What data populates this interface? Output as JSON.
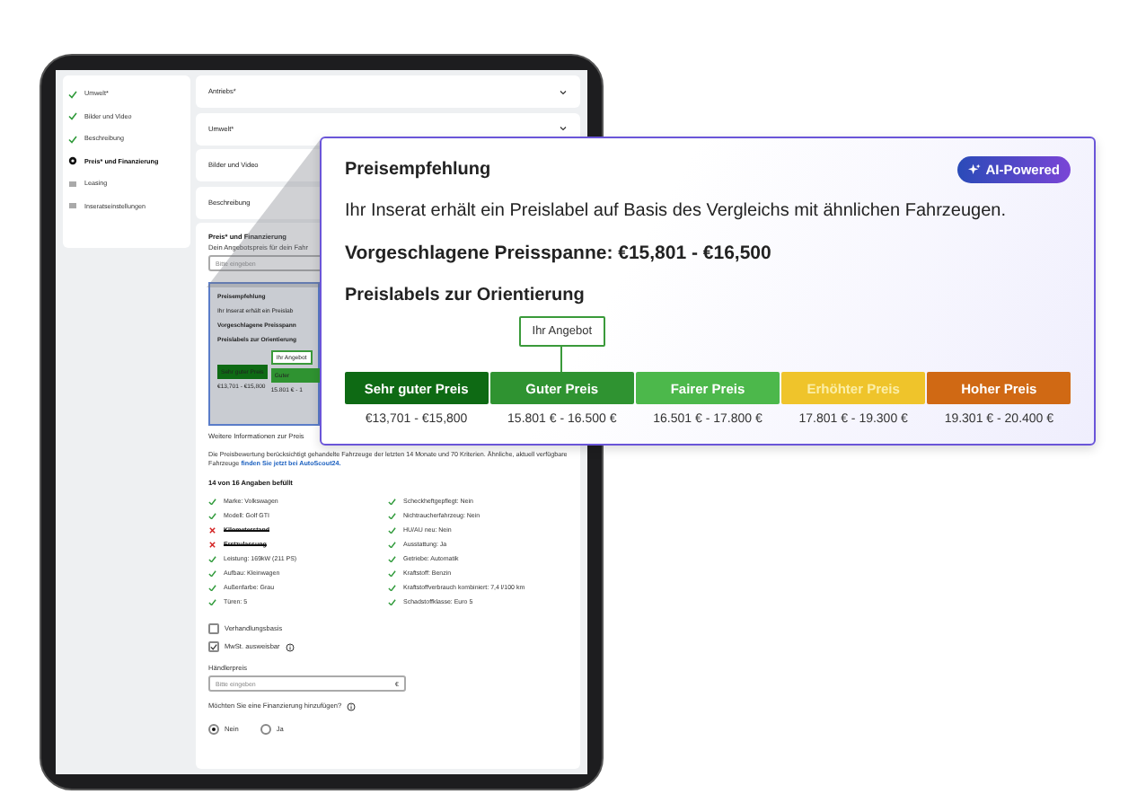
{
  "sidebar": {
    "items": [
      {
        "label": "Umwelt*",
        "kind": "done",
        "selected": false
      },
      {
        "label": "Bilder und Video",
        "kind": "done",
        "selected": false
      },
      {
        "label": "Beschreibung",
        "kind": "done",
        "selected": false
      },
      {
        "label": "Preis* und Finanzierung",
        "kind": "current",
        "selected": true
      },
      {
        "label": "Leasing",
        "kind": "todo",
        "selected": false
      },
      {
        "label": "Inseratseinstellungen",
        "kind": "todo",
        "selected": false
      }
    ]
  },
  "sections": [
    {
      "title": "Antriebs*"
    },
    {
      "title": "Umwelt*"
    },
    {
      "title": "Bilder und Video"
    },
    {
      "title": "Beschreibung"
    }
  ],
  "price_section": {
    "title": "Preis* und Finanzierung",
    "hint": "Dein Angebotspreis für dein Fahr",
    "placeholder": "Bitte eingeben",
    "preview": {
      "title": "Preisempfehlung",
      "text": "Ihr Inserat erhält ein Preislab",
      "range": "Vorgeschlagene Preisspann",
      "labels_heading": "Preislabels zur Orientierung",
      "marker": "Ihr Angebot",
      "labels": [
        {
          "label": "Sehr guter Preis",
          "range": "€13,701 - €15,800",
          "color": "#0e6a14",
          "selected": false
        },
        {
          "label": "Guter",
          "range": "15.801 € - 1",
          "color": "#2f9331",
          "selected": true
        }
      ]
    },
    "more_info": "Weitere Informationen zur Preis",
    "note": "Die Preisbewertung berücksichtigt gehandelte Fahrzeuge der letzten 14 Monate und 70 Kriterien. Ähnliche, aktuell verfügbare Fahrzeuge ",
    "note_link": "finden Sie jetzt bei AutoScout24.",
    "filled": "14 von 16 Angaben befüllt",
    "attributes_left": [
      {
        "text": "Marke: Volkswagen",
        "ok": true
      },
      {
        "text": "Modell: Golf GTI",
        "ok": true
      },
      {
        "text": "Kilometerstand",
        "ok": false
      },
      {
        "text": "Erstzulassung",
        "ok": false
      },
      {
        "text": "Leistung: 169kW (211 PS)",
        "ok": true
      },
      {
        "text": "Aufbau: Kleinwagen",
        "ok": true
      },
      {
        "text": "Außenfarbe: Grau",
        "ok": true
      },
      {
        "text": "Türen: 5",
        "ok": true
      }
    ],
    "attributes_right": [
      {
        "text": "Scheckheftgepflegt: Nein",
        "ok": true
      },
      {
        "text": "Nichtraucherfahrzeug: Nein",
        "ok": true
      },
      {
        "text": "HU/AU neu: Nein",
        "ok": true
      },
      {
        "text": "Ausstattung: Ja",
        "ok": true
      },
      {
        "text": "Getriebe: Automatik",
        "ok": true
      },
      {
        "text": "Kraftstoff: Benzin",
        "ok": true
      },
      {
        "text": "Kraftstoffverbrauch kombiniert: 7,4 l/100 km",
        "ok": true
      },
      {
        "text": "Schadstoffklasse: Euro 5",
        "ok": true
      }
    ],
    "checkboxes": [
      {
        "label": "Verhandlungsbasis",
        "checked": false,
        "info": false
      },
      {
        "label": "MwSt. ausweisbar",
        "checked": true,
        "info": true
      }
    ],
    "dealer_price": {
      "label": "Händlerpreis",
      "placeholder": "Bitte eingeben",
      "unit": "€"
    },
    "financing": {
      "question": "Möchten Sie eine Finanzierung hinzufügen?",
      "options": [
        {
          "label": "Nein",
          "selected": true
        },
        {
          "label": "Ja",
          "selected": false
        }
      ]
    }
  },
  "callout": {
    "title": "Preisempfehlung",
    "badge": "AI-Powered",
    "text": "Ihr Inserat erhält ein Preislabel auf Basis des Vergleichs mit ähnlichen Fahrzeugen.",
    "range": "Vorgeschlagene Preisspanne: €15,801 - €16,500",
    "labels_heading": "Preislabels zur Orientierung",
    "marker": "Ihr Angebot",
    "labels": [
      {
        "label": "Sehr guter Preis",
        "range": "€13,701 - €15,800",
        "color": "#0e6a14",
        "selected": false
      },
      {
        "label": "Guter Preis",
        "range": "15.801 € - 16.500 €",
        "color": "#2f9331",
        "selected": true
      },
      {
        "label": "Fairer Preis",
        "range": "16.501 € - 17.800 €",
        "color": "#4cb84b",
        "selected": false
      },
      {
        "label": "Erhöhter Preis",
        "range": "17.801 € - 19.300 €",
        "color": "#efc42b",
        "selected": false
      },
      {
        "label": "Hoher Preis",
        "range": "19.301 € - 20.400 €",
        "color": "#d06914",
        "selected": false
      }
    ]
  }
}
